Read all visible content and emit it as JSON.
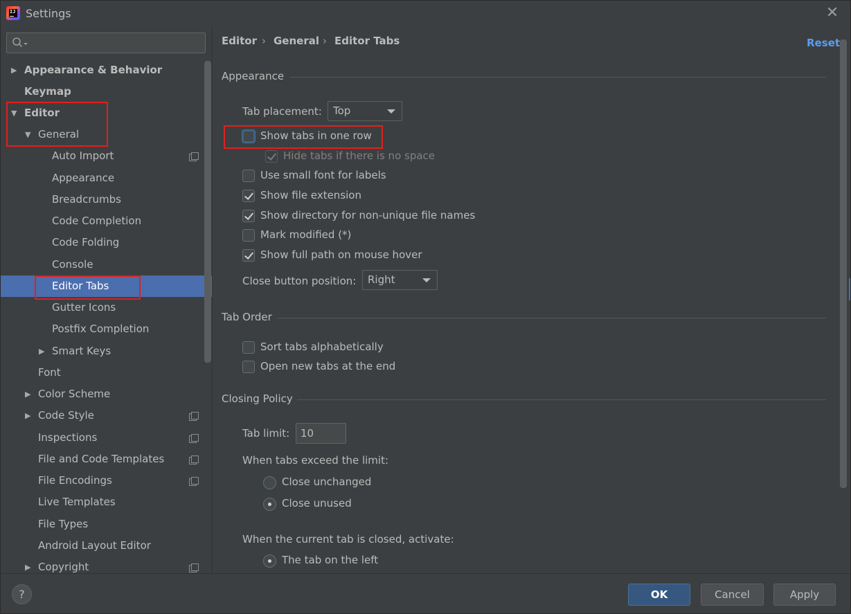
{
  "window": {
    "title": "Settings",
    "icon": "intellij-idea-icon",
    "close_icon": "close-icon"
  },
  "search": {
    "placeholder": "",
    "icon": "search-icon"
  },
  "sidebar": {
    "items": [
      {
        "label": "Appearance & Behavior",
        "level": 0,
        "arrow": "collapsed",
        "bold": true
      },
      {
        "label": "Keymap",
        "level": 0,
        "arrow": "none",
        "bold": true
      },
      {
        "label": "Editor",
        "level": 0,
        "arrow": "expanded",
        "bold": true
      },
      {
        "label": "General",
        "level": 1,
        "arrow": "expanded"
      },
      {
        "label": "Auto Import",
        "level": 2,
        "project_icon": true
      },
      {
        "label": "Appearance",
        "level": 2
      },
      {
        "label": "Breadcrumbs",
        "level": 2
      },
      {
        "label": "Code Completion",
        "level": 2
      },
      {
        "label": "Code Folding",
        "level": 2
      },
      {
        "label": "Console",
        "level": 2
      },
      {
        "label": "Editor Tabs",
        "level": 2,
        "selected": true
      },
      {
        "label": "Gutter Icons",
        "level": 2
      },
      {
        "label": "Postfix Completion",
        "level": 2
      },
      {
        "label": "Smart Keys",
        "level": 2,
        "arrow": "collapsed"
      },
      {
        "label": "Font",
        "level": 1
      },
      {
        "label": "Color Scheme",
        "level": 1,
        "arrow": "collapsed"
      },
      {
        "label": "Code Style",
        "level": 1,
        "arrow": "collapsed",
        "project_icon": true
      },
      {
        "label": "Inspections",
        "level": 1,
        "project_icon": true
      },
      {
        "label": "File and Code Templates",
        "level": 1,
        "project_icon": true
      },
      {
        "label": "File Encodings",
        "level": 1,
        "project_icon": true
      },
      {
        "label": "Live Templates",
        "level": 1
      },
      {
        "label": "File Types",
        "level": 1
      },
      {
        "label": "Android Layout Editor",
        "level": 1
      },
      {
        "label": "Copyright",
        "level": 1,
        "arrow": "collapsed",
        "project_icon": true
      }
    ]
  },
  "breadcrumb": {
    "items": [
      "Editor",
      "General",
      "Editor Tabs"
    ],
    "separator": "›"
  },
  "reset_label": "Reset",
  "appearance": {
    "title": "Appearance",
    "tab_placement_label": "Tab placement:",
    "tab_placement_value": "Top",
    "show_tabs_one_row": {
      "label": "Show tabs in one row",
      "checked": false
    },
    "hide_tabs": {
      "label": "Hide tabs if there is no space",
      "checked": true,
      "disabled": true
    },
    "small_font": {
      "label": "Use small font for labels",
      "checked": false
    },
    "show_extension": {
      "label": "Show file extension",
      "checked": true
    },
    "show_directory": {
      "label": "Show directory for non-unique file names",
      "checked": true
    },
    "mark_modified": {
      "label": "Mark modified (*)",
      "checked": false
    },
    "show_full_path": {
      "label": "Show full path on mouse hover",
      "checked": true
    },
    "close_button_label": "Close button position:",
    "close_button_value": "Right"
  },
  "tab_order": {
    "title": "Tab Order",
    "sort_alpha": {
      "label": "Sort tabs alphabetically",
      "checked": false
    },
    "open_at_end": {
      "label": "Open new tabs at the end",
      "checked": false
    }
  },
  "closing_policy": {
    "title": "Closing Policy",
    "tab_limit_label": "Tab limit:",
    "tab_limit_value": "10",
    "exceed_label": "When tabs exceed the limit:",
    "close_unchanged": {
      "label": "Close unchanged",
      "selected": false
    },
    "close_unused": {
      "label": "Close unused",
      "selected": true
    },
    "activate_label": "When the current tab is closed, activate:",
    "tab_on_left": {
      "label": "The tab on the left",
      "selected": true
    }
  },
  "footer": {
    "help_label": "?",
    "ok_label": "OK",
    "cancel_label": "Cancel",
    "apply_label": "Apply"
  },
  "colors": {
    "background": "#3c3f41",
    "selection": "#4b6eaf",
    "link": "#589df6",
    "highlight": "#e0201e",
    "default_button": "#365880"
  }
}
